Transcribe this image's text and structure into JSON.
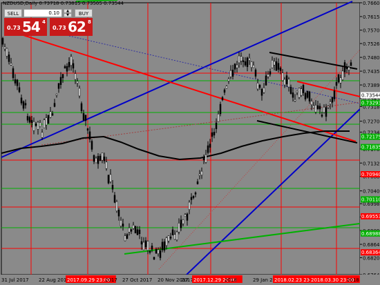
{
  "window": {
    "title": "NZDUSD,Daily  0.73718 0.73815 0.73505 0.73544"
  },
  "trade_panel": {
    "sell_label": "SELL",
    "buy_label": "BUY",
    "lot_value": "0.10",
    "sell_price_small": "0.73",
    "sell_price_big": "54",
    "sell_price_sup": "4",
    "buy_price_small": "0.73",
    "buy_price_big": "62",
    "buy_price_sup": "8",
    "spin_up_icon": "arrow-up-icon",
    "spin_down_icon": "arrow-down-icon"
  },
  "colors": {
    "background": "#8a8a8a",
    "candle": "#000000",
    "red_line": "#ff0000",
    "green_line": "#00b000",
    "blue_line": "#0000c8",
    "ma_line": "#000000"
  },
  "chart_data": {
    "type": "candlestick",
    "symbol": "NZDUSD",
    "timeframe": "Daily",
    "ohlc_header": [
      "0.73718",
      "0.73815",
      "0.73505",
      "0.73544"
    ],
    "ylim": [
      0.6764,
      0.76605
    ],
    "price_ticks": [
      "0.76605",
      "0.76150",
      "0.75702",
      "0.75260",
      "0.74805",
      "0.74350",
      "0.73895",
      "0.73450",
      "0.73185",
      "0.72700",
      "0.72340",
      "0.71785",
      "0.71320",
      "0.70880",
      "0.70402",
      "0.69980",
      "0.69540",
      "0.69095",
      "0.68640",
      "0.68200",
      "0.67640"
    ],
    "price_labels": [
      {
        "text": "0.73544",
        "bg": "#ffffff",
        "fg": "#000000",
        "value": 0.73544
      },
      {
        "text": "0.73293",
        "bg": "#00b000",
        "fg": "#ffffff",
        "value": 0.73293
      },
      {
        "text": "0.72175",
        "bg": "#00b000",
        "fg": "#ffffff",
        "value": 0.72175
      },
      {
        "text": "0.71835",
        "bg": "#00b000",
        "fg": "#ffffff",
        "value": 0.71835
      },
      {
        "text": "0.70940",
        "bg": "#ff0000",
        "fg": "#ffffff",
        "value": 0.7094
      },
      {
        "text": "0.70110",
        "bg": "#00b000",
        "fg": "#ffffff",
        "value": 0.7011
      },
      {
        "text": "0.69553",
        "bg": "#ff0000",
        "fg": "#ffffff",
        "value": 0.69553
      },
      {
        "text": "0.68988",
        "bg": "#00b000",
        "fg": "#ffffff",
        "value": 0.68988
      },
      {
        "text": "0.68364",
        "bg": "#ff0000",
        "fg": "#ffffff",
        "value": 0.68364
      }
    ],
    "time_labels": [
      {
        "text": "31 Jul 2017",
        "highlight": false
      },
      {
        "text": "22 Aug 2017",
        "highlight": false
      },
      {
        "text": "2017.09.29 23:00",
        "highlight": true
      },
      {
        "text": "2017",
        "highlight": false
      },
      {
        "text": "27 Oct 2017",
        "highlight": false
      },
      {
        "text": "20 Nov 2017",
        "highlight": false
      },
      {
        "text": "2017",
        "highlight": false
      },
      {
        "text": "2017.12.29 20:00",
        "highlight": true
      },
      {
        "text": "2018",
        "highlight": false
      },
      {
        "text": "29 Jan 2018",
        "highlight": false
      },
      {
        "text": "2018.02.23 23:00",
        "highlight": true
      },
      {
        "text": "14",
        "highlight": false
      },
      {
        "text": "2018.03.30 23:00",
        "highlight": true
      },
      {
        "text": "2018",
        "highlight": false
      }
    ]
  }
}
